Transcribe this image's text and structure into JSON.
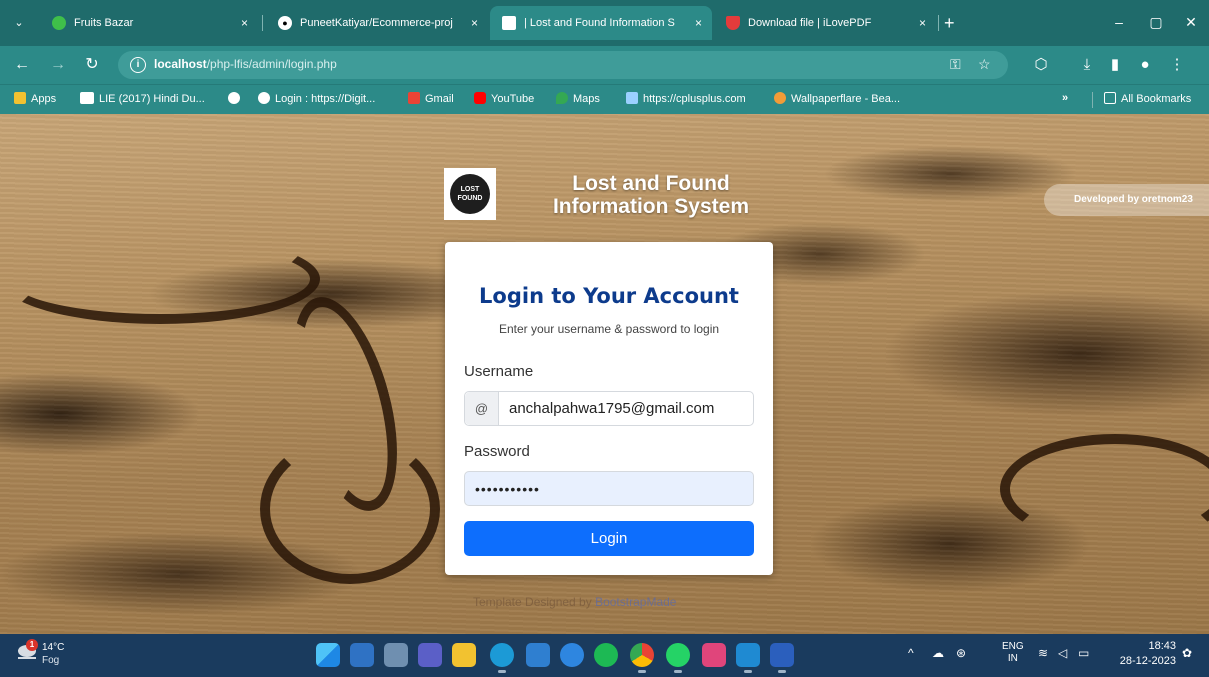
{
  "browser": {
    "tabs": [
      {
        "title": "Fruits Bazar",
        "icon": "fruits-bazar-favicon",
        "active": false
      },
      {
        "title": "PuneetKatiyar/Ecommerce-proj",
        "icon": "github-icon",
        "active": false
      },
      {
        "title": "| Lost and Found Information S",
        "icon": "lfis-favicon",
        "active": true
      },
      {
        "title": "Download file | iLovePDF",
        "icon": "ilovepdf-favicon",
        "active": false
      }
    ],
    "close_glyph": "×",
    "new_tab_glyph": "+",
    "url_host": "localhost",
    "url_path": "/php-lfis/admin/login.php",
    "bookmarks": [
      {
        "label": "Apps",
        "icon": "apps-grid-icon"
      },
      {
        "label": "LIE (2017) Hindi Du...",
        "icon": "sky-icon"
      },
      {
        "label": "",
        "icon": "chrome-globe-icon"
      },
      {
        "label": "Login : https://Digit...",
        "icon": "wordpress-icon"
      },
      {
        "label": "Gmail",
        "icon": "gmail-icon"
      },
      {
        "label": "YouTube",
        "icon": "youtube-icon"
      },
      {
        "label": "Maps",
        "icon": "maps-icon"
      },
      {
        "label": "https://cplusplus.com",
        "icon": "cplusplus-icon"
      },
      {
        "label": "Wallpaperflare - Bea...",
        "icon": "wallpaperflare-icon"
      }
    ],
    "bookmarks_overflow": "»",
    "all_bookmarks": "All Bookmarks"
  },
  "page": {
    "brand_title": "Lost and Found Information System",
    "logo_text_line1": "LOST",
    "logo_text_line2": "FOUND",
    "developer_badge": "Developed by oretnom23",
    "login": {
      "title": "Login to Your Account",
      "subtitle": "Enter your username & password to login",
      "username_label": "Username",
      "username_prefix": "@",
      "username_value": "anchalpahwa1795@gmail.com",
      "password_label": "Password",
      "password_value": "•••••••••••",
      "button_label": "Login"
    },
    "credits_prefix": "Template Designed by ",
    "credits_link": "BootstrapMade"
  },
  "taskbar": {
    "weather_temp": "14°C",
    "weather_condition": "Fog",
    "weather_badge": "1",
    "apps": [
      {
        "name": "windows-start-icon",
        "color": "#3aa0f0",
        "running": false
      },
      {
        "name": "app-blue-yellow-icon",
        "color": "#2f72c4",
        "running": false
      },
      {
        "name": "task-view-icon",
        "color": "#6f8fb0",
        "running": false
      },
      {
        "name": "teams-icon",
        "color": "#5b5fc7",
        "running": false
      },
      {
        "name": "file-explorer-icon",
        "color": "#f2c230",
        "running": false
      },
      {
        "name": "edge-icon",
        "color": "#1c9ad6",
        "running": true
      },
      {
        "name": "microsoft-store-icon",
        "color": "#2f7fd0",
        "running": false
      },
      {
        "name": "app-photos-icon",
        "color": "#2e86e0",
        "running": false
      },
      {
        "name": "spotify-icon",
        "color": "#1db954",
        "running": false
      },
      {
        "name": "chrome-icon",
        "color": "#e8b43a",
        "running": true
      },
      {
        "name": "whatsapp-icon",
        "color": "#25d366",
        "running": true
      },
      {
        "name": "app-pink-icon",
        "color": "#e0457b",
        "running": false
      },
      {
        "name": "vscode-icon",
        "color": "#1f8ad2",
        "running": true
      },
      {
        "name": "word-icon",
        "color": "#2b5fbd",
        "running": true
      }
    ],
    "lang_line1": "ENG",
    "lang_line2": "IN",
    "time": "18:43",
    "date": "28-12-2023"
  },
  "colors": {
    "tabbar": "#1f6b6b",
    "toolbar": "#2c8a88",
    "card_title": "#0d3b8c",
    "login_button": "#0d6efd",
    "password_fill": "#e8f0fe",
    "taskbar": "#1a3b5e"
  }
}
